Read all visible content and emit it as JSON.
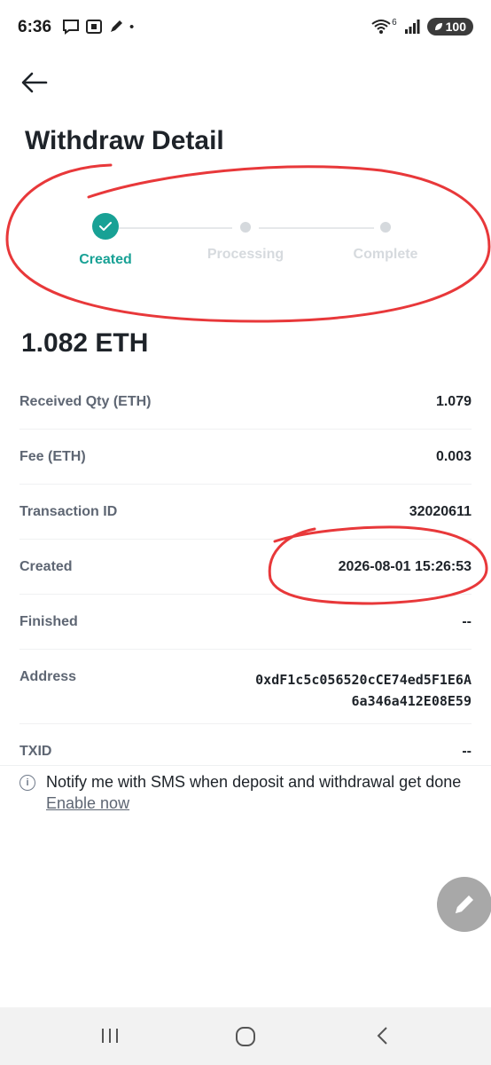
{
  "status_bar": {
    "time": "6:36",
    "signal_superscript": "6",
    "battery": "100"
  },
  "header": {
    "title": "Withdraw Detail"
  },
  "steps": [
    {
      "label": "Created",
      "state": "done"
    },
    {
      "label": "Processing",
      "state": "pending"
    },
    {
      "label": "Complete",
      "state": "pending"
    }
  ],
  "amount": "1.082 ETH",
  "details": {
    "received_qty": {
      "label": "Received Qty (ETH)",
      "value": "1.079"
    },
    "fee": {
      "label": "Fee (ETH)",
      "value": "0.003"
    },
    "transaction_id": {
      "label": "Transaction ID",
      "value": "32020611"
    },
    "created": {
      "label": "Created",
      "value": "2026-08-01 15:26:53"
    },
    "finished": {
      "label": "Finished",
      "value": "--"
    },
    "address": {
      "label": "Address",
      "value_line1": "0xdF1c5c056520cCE74ed5F1E6A",
      "value_line2": "6a346a412E08E59"
    },
    "txid": {
      "label": "TXID",
      "value": "--"
    }
  },
  "notice": {
    "text": "Notify me with SMS when deposit and withdrawal get done",
    "link": " Enable now"
  },
  "colors": {
    "accent": "#18a195",
    "annotation": "#e8383a"
  }
}
